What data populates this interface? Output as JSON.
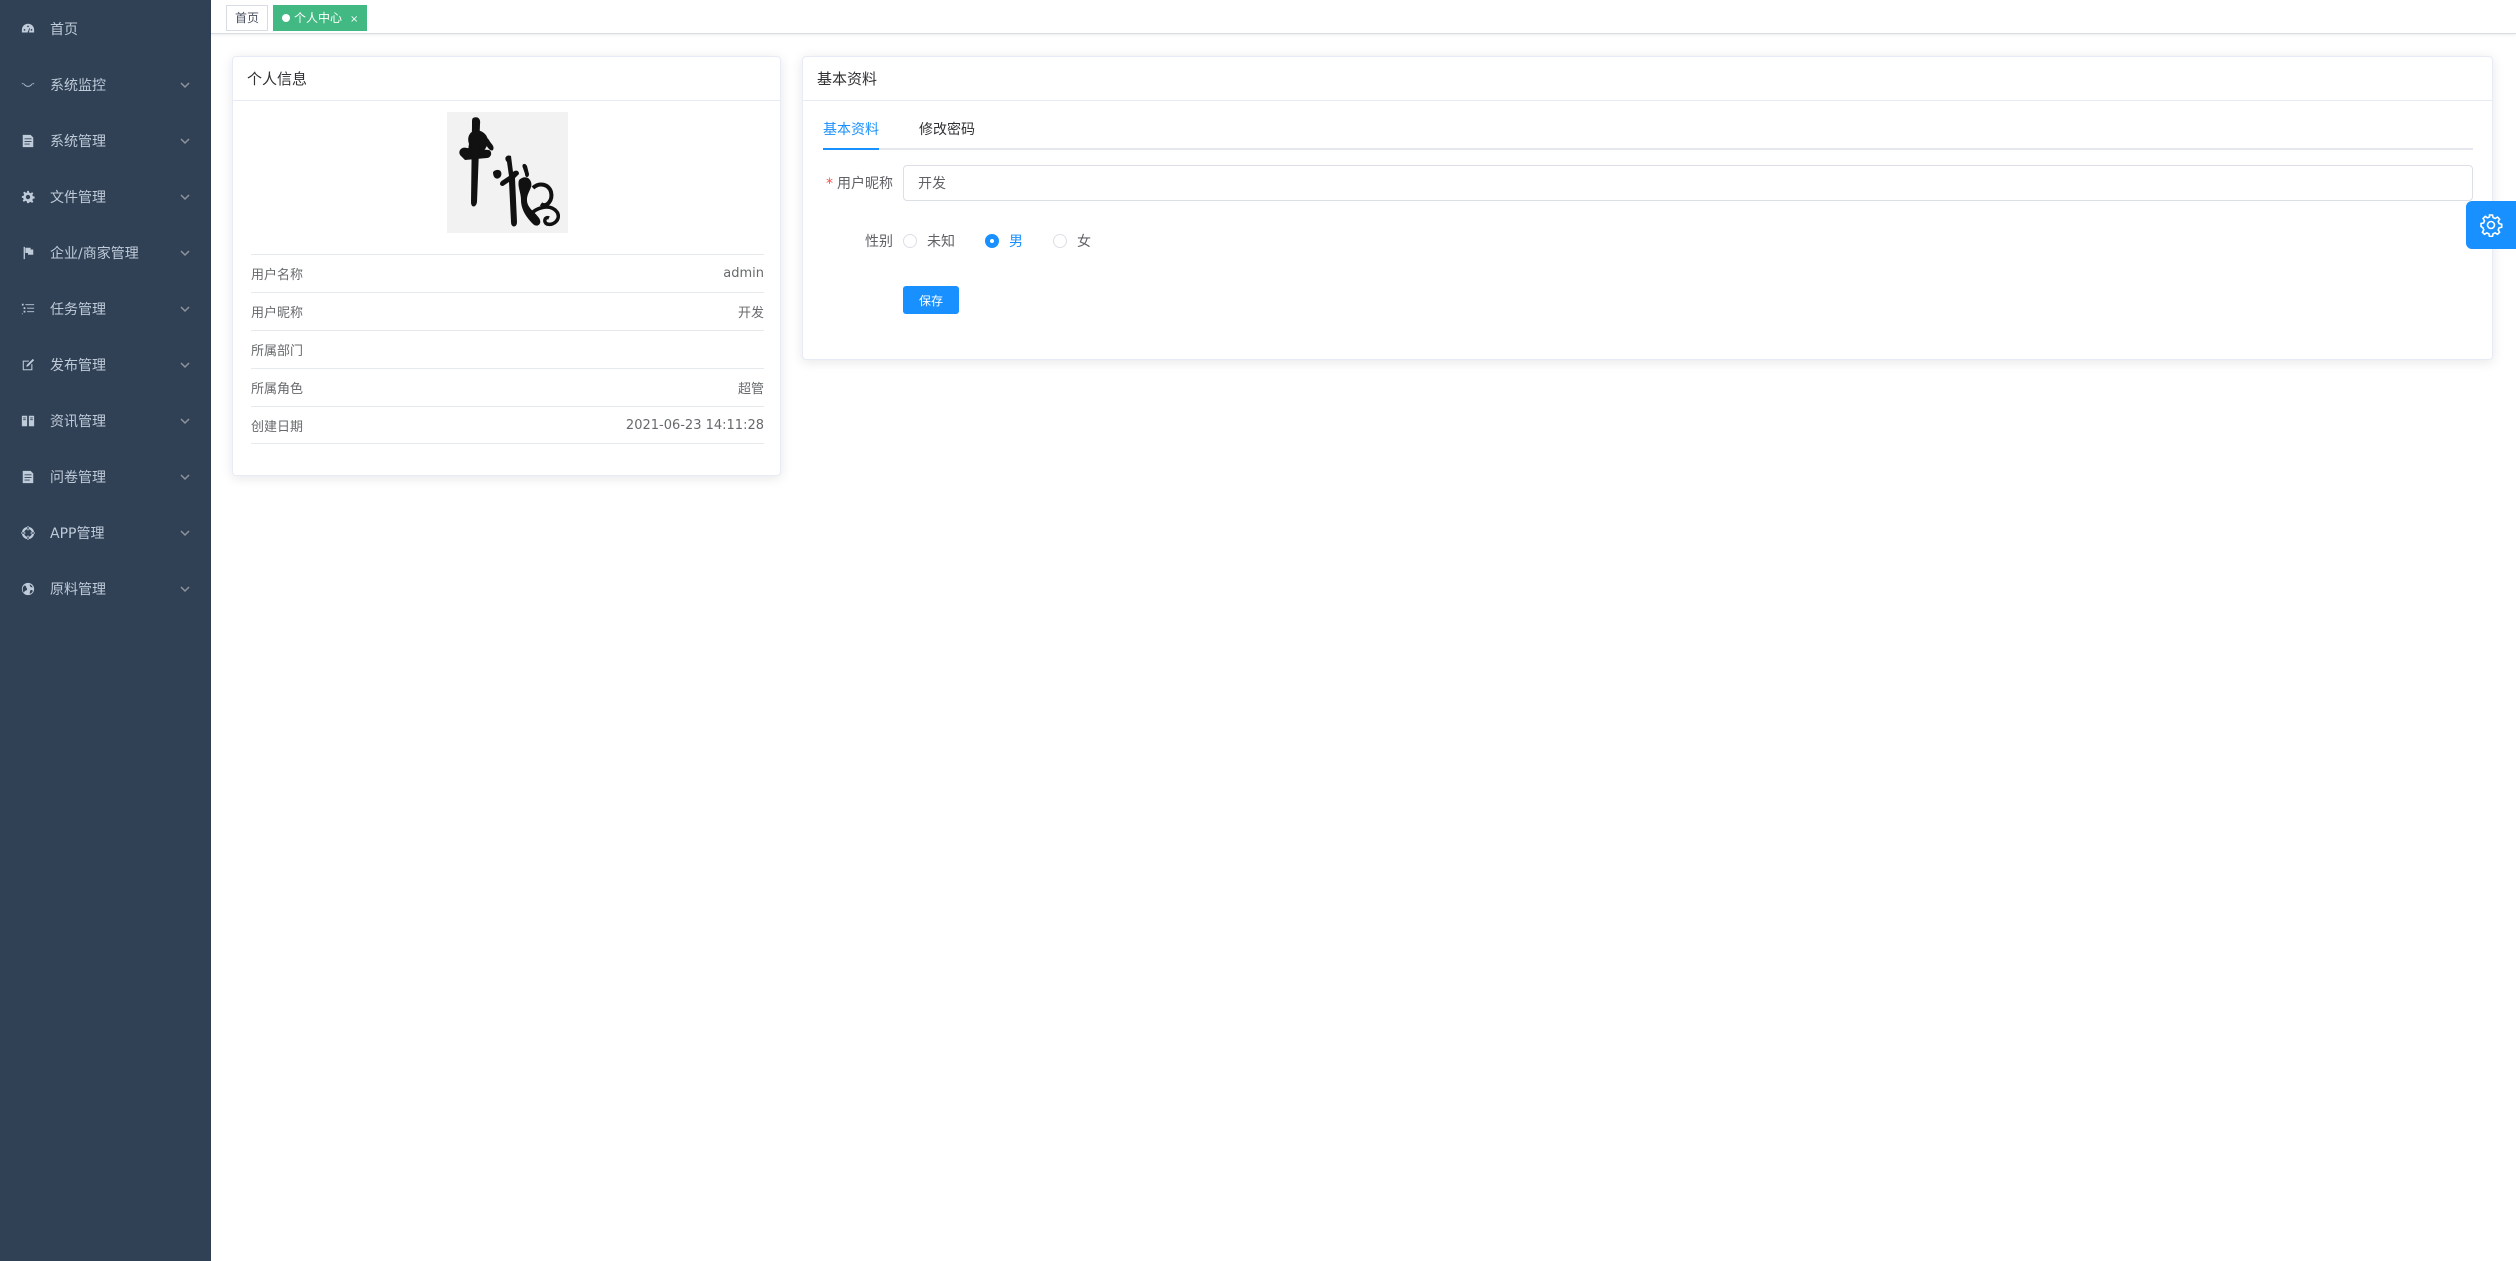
{
  "sidebar": {
    "items": [
      {
        "label": "首页",
        "icon": "dashboard-icon",
        "has_arrow": false
      },
      {
        "label": "系统监控",
        "icon": "monitor-icon",
        "has_arrow": true
      },
      {
        "label": "系统管理",
        "icon": "system-icon",
        "has_arrow": true
      },
      {
        "label": "文件管理",
        "icon": "gear-icon",
        "has_arrow": true
      },
      {
        "label": "企业/商家管理",
        "icon": "flag-icon",
        "has_arrow": true
      },
      {
        "label": "任务管理",
        "icon": "list-icon",
        "has_arrow": true
      },
      {
        "label": "发布管理",
        "icon": "edit-icon",
        "has_arrow": true
      },
      {
        "label": "资讯管理",
        "icon": "book-icon",
        "has_arrow": true
      },
      {
        "label": "问卷管理",
        "icon": "form-icon",
        "has_arrow": true
      },
      {
        "label": "APP管理",
        "icon": "app-icon",
        "has_arrow": true
      },
      {
        "label": "原料管理",
        "icon": "globe-icon",
        "has_arrow": true
      }
    ]
  },
  "tags": {
    "home": "首页",
    "current": "个人中心",
    "close": "×"
  },
  "profile_card": {
    "title": "个人信息",
    "avatar_text": "中秋",
    "rows": [
      {
        "key": "用户名称",
        "value": "admin"
      },
      {
        "key": "用户昵称",
        "value": "开发"
      },
      {
        "key": "所属部门",
        "value": ""
      },
      {
        "key": "所属角色",
        "value": "超管"
      },
      {
        "key": "创建日期",
        "value": "2021-06-23 14:11:28"
      }
    ]
  },
  "basic_card": {
    "title": "基本资料",
    "tabs": [
      "基本资料",
      "修改密码"
    ],
    "active_tab": 0,
    "nickname_label": "用户昵称",
    "nickname_value": "开发",
    "gender_label": "性别",
    "gender_options": [
      "未知",
      "男",
      "女"
    ],
    "gender_selected": 1,
    "save_label": "保存"
  },
  "colors": {
    "sidebar_bg": "#304156",
    "primary": "#1890ff",
    "tag_active": "#42b983"
  }
}
